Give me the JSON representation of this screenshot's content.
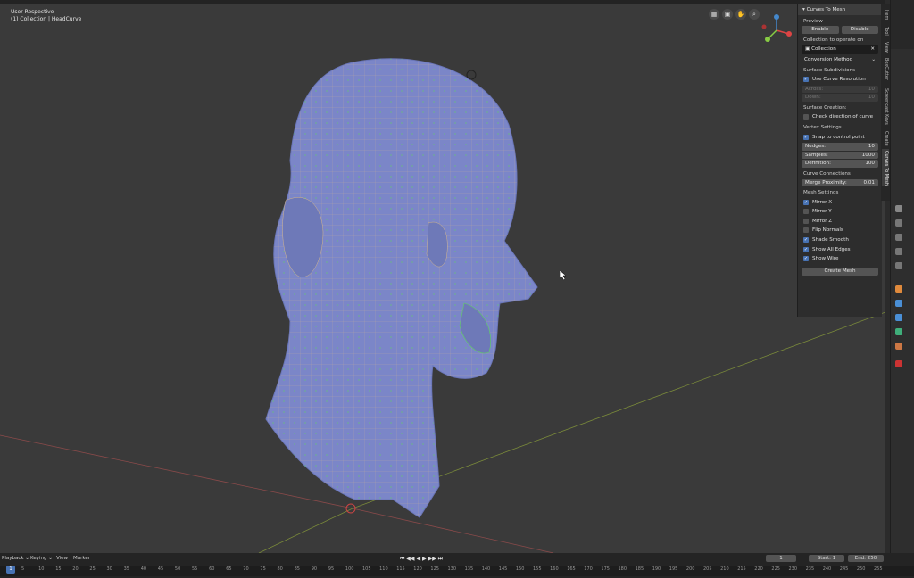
{
  "viewport": {
    "label_perspective": "User Respective",
    "label_collection": "(1) Collection | HeadCurve",
    "nav_icons": [
      "camera-icon",
      "video-icon",
      "hand-icon",
      "zoom-icon"
    ]
  },
  "npanel": {
    "title": "Curves To Mesh",
    "preview_label": "Preview",
    "enable": "Enable",
    "disable": "Disable",
    "collection_label": "Collection to operate on",
    "collection_value": "Collection",
    "clear_symbol": "✕",
    "conversion_method": "Conversion Method",
    "surface_subdivisions": "Surface Subdivisions",
    "use_curve_resolution": "Use Curve Resolution",
    "across_label": "Across:",
    "across_value": "10",
    "down_label": "Down:",
    "down_value": "10",
    "surface_creation": "Surface Creation:",
    "check_direction": "Check direction of curve",
    "vertex_settings": "Vertex Settings",
    "snap": "Snap to control point",
    "nudges_label": "Nudges:",
    "nudges_value": "10",
    "samples_label": "Samples:",
    "samples_value": "1000",
    "definition_label": "Definition:",
    "definition_value": "100",
    "curve_connections": "Curve Connections",
    "merge_label": "Merge Proximity:",
    "merge_value": "0.01",
    "mesh_settings": "Mesh Settings",
    "mirror_x": "Mirror X",
    "mirror_y": "Mirror Y",
    "mirror_z": "Mirror Z",
    "flip_normals": "Flip Normals",
    "shade_smooth": "Shade Smooth",
    "show_all_edges": "Show All Edges",
    "show_wire": "Show Wire",
    "create_mesh": "Create Mesh",
    "checkmark": "✓"
  },
  "vtabs": [
    "Item",
    "Tool",
    "View",
    "BoxCutter",
    "Screencast Keys",
    "Create",
    "Curves To Mesh"
  ],
  "timeline": {
    "playback": "Playback",
    "keying": "Keying",
    "view": "View",
    "marker": "Marker",
    "current_frame": "1",
    "frame_value": "1",
    "start_label": "Start:",
    "start_value": "1",
    "end_label": "End:",
    "end_value": "250",
    "controls": "⏮ ◀◀ ◀ ▶ ▶▶ ⏭",
    "ticks": [
      "5",
      "10",
      "15",
      "20",
      "25",
      "30",
      "35",
      "40",
      "45",
      "50",
      "55",
      "60",
      "65",
      "70",
      "75",
      "80",
      "85",
      "90",
      "95",
      "100",
      "105",
      "110",
      "115",
      "120",
      "125",
      "130",
      "135",
      "140",
      "145",
      "150",
      "155",
      "160",
      "165",
      "170",
      "175",
      "180",
      "185",
      "190",
      "195",
      "200",
      "205",
      "210",
      "215",
      "220",
      "225",
      "230",
      "235",
      "240",
      "245",
      "250",
      "255"
    ]
  },
  "colors": {
    "accent": "#4772b3",
    "mesh": "#7b86c8",
    "wire": "#d8b88a",
    "vertex": "#5fd35f"
  }
}
